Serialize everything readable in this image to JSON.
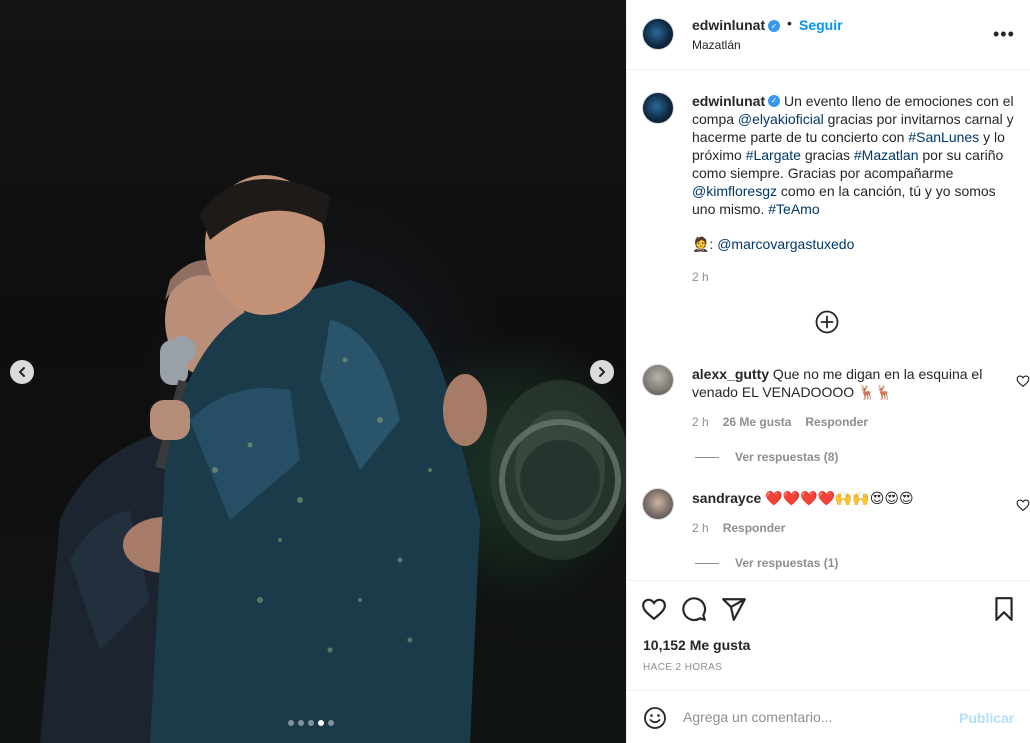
{
  "post": {
    "username": "edwinlunat",
    "follow_label": "Seguir",
    "separator": "•",
    "location": "Mazatlán",
    "more_icon": "more-options-icon"
  },
  "caption": {
    "username": "edwinlunat",
    "t1": " Un evento lleno de emociones con el compa ",
    "mention1": "@elyakioficial",
    "t2": " gracias por invitarnos carnal y hacerme parte de tu concierto con ",
    "tag1": "#SanLunes",
    "t3": " y lo próximo ",
    "tag2": "#Largate",
    "t4": " gracias ",
    "tag3": "#Mazatlan",
    "t5": " por su cariño como siempre. Gracias por acompañarme ",
    "mention2": "@kimfloresgz",
    "t6": " como en la canción, tú y yo somos uno mismo. ",
    "tag4": "#TeAmo",
    "credit_emoji": "🤵",
    "credit_sep": ": ",
    "credit_mention": "@marcovargastuxedo",
    "time": "2 h"
  },
  "comments": [
    {
      "username": "alexx_gutty",
      "text": " Que no me digan en la esquina el venado EL VENADOOOO 🦌🦌",
      "time": "2 h",
      "likes": "26 Me gusta",
      "reply": "Responder",
      "view_replies": "Ver respuestas (8)"
    },
    {
      "username": "sandrayce",
      "text": " ❤️❤️❤️❤️🙌🙌😍😍😍",
      "time": "2 h",
      "reply": "Responder",
      "view_replies": "Ver respuestas (1)"
    }
  ],
  "stats": {
    "likes": "10,152 Me gusta",
    "posted": "HACE 2 HORAS"
  },
  "add_comment": {
    "placeholder": "Agrega un comentario...",
    "publish": "Publicar"
  },
  "carousel": {
    "count": 5,
    "active_index": 3
  },
  "colors": {
    "accent": "#0095f6",
    "link": "#00376b",
    "verified": "#3897f0",
    "muted": "#8e8e8e",
    "publish_disabled": "#b2dffc"
  }
}
